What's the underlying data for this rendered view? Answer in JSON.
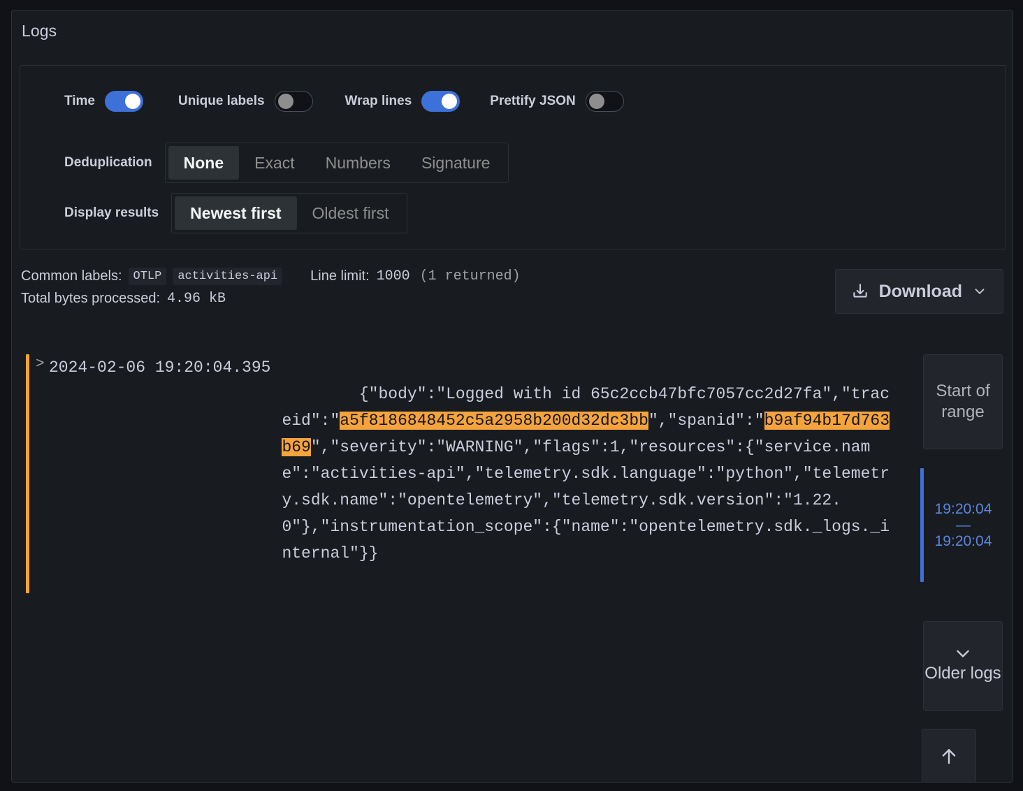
{
  "panel": {
    "title": "Logs"
  },
  "options": {
    "toggles": [
      {
        "label": "Time",
        "state": "on",
        "icon": "toggle-switch"
      },
      {
        "label": "Unique labels",
        "state": "off",
        "icon": "toggle-switch"
      },
      {
        "label": "Wrap lines",
        "state": "on",
        "icon": "toggle-switch"
      },
      {
        "label": "Prettify JSON",
        "state": "off",
        "icon": "toggle-switch"
      }
    ],
    "deduplication": {
      "label": "Deduplication",
      "options": [
        "None",
        "Exact",
        "Numbers",
        "Signature"
      ],
      "selected": "None"
    },
    "display_results": {
      "label": "Display results",
      "options": [
        "Newest first",
        "Oldest first"
      ],
      "selected": "Newest first"
    }
  },
  "meta": {
    "common_labels_label": "Common labels:",
    "common_labels": [
      "OTLP",
      "activities-api"
    ],
    "line_limit_label": "Line limit:",
    "line_limit_value": "1000",
    "line_limit_returned": "(1 returned)",
    "total_bytes_label": "Total bytes processed:",
    "total_bytes_value": "4.96 kB"
  },
  "download": {
    "label": "Download",
    "icon": "download-icon",
    "chevron": "chevron-down-icon"
  },
  "log_entry": {
    "expand_icon": ">",
    "timestamp": "2024-02-06 19:20:04.395",
    "severity": "WARNING",
    "severity_color": "#f5a33c",
    "body_segments": [
      {
        "text": "{\"body\":\"Logged with id 65c2ccb47bfc7057cc2d27fa\",\"traceid\":\"",
        "highlight": false
      },
      {
        "text": "a5f8186848452c5a2958b200d32dc3bb",
        "highlight": true
      },
      {
        "text": "\",\"spanid\":\"",
        "highlight": false
      },
      {
        "text": "b9af94b17d763b69",
        "highlight": true
      },
      {
        "text": "\",\"severity\":\"WARNING\",\"flags\":1,\"resources\":{\"service.name\":\"activities-api\",\"telemetry.sdk.language\":\"python\",\"telemetry.sdk.name\":\"opentelemetry\",\"telemetry.sdk.version\":\"1.22.0\"},\"instrumentation_scope\":{\"name\":\"opentelemetry.sdk._logs._internal\"}}",
        "highlight": false
      }
    ]
  },
  "rail": {
    "start_of_range": "Start of range",
    "time_range_start": "19:20:04",
    "time_range_dash": "—",
    "time_range_end": "19:20:04",
    "older_logs": "Older logs",
    "older_logs_icon": "chevron-down-icon",
    "scroll_top_icon": "arrow-up-icon"
  },
  "colors": {
    "accent_blue": "#3d71d9",
    "warning_orange": "#f5a33c",
    "panel_bg": "#181b1f",
    "page_bg": "#111217",
    "text_primary": "#ccccdc"
  }
}
